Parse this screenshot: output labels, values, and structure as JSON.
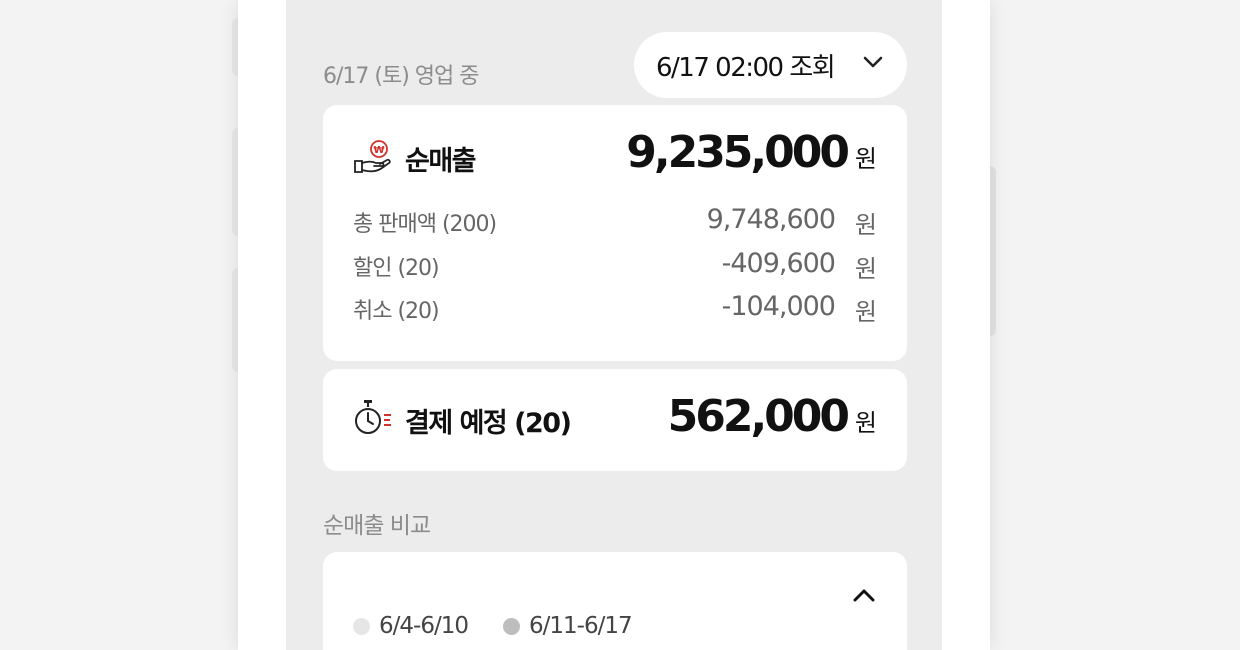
{
  "status": {
    "text": "6/17 (토) 영업 중"
  },
  "query": {
    "label": "6/17 02:00 조회"
  },
  "net_sales": {
    "title": "순매출",
    "amount": "9,235,000",
    "unit": "원",
    "rows": [
      {
        "label": "총 판매액 (200)",
        "amount": "9,748,600",
        "unit": "원"
      },
      {
        "label": "할인 (20)",
        "amount": "-409,600",
        "unit": "원"
      },
      {
        "label": "취소 (20)",
        "amount": "-104,000",
        "unit": "원"
      }
    ]
  },
  "pending": {
    "title": "결제 예정 (20)",
    "amount": "562,000",
    "unit": "원"
  },
  "compare": {
    "title": "순매출 비교",
    "legend": [
      {
        "label": "6/4-6/10",
        "color": "#e6e6e6"
      },
      {
        "label": "6/11-6/17",
        "color": "#bdbdbd"
      }
    ]
  },
  "colors": {
    "accent": "#d0312d",
    "screen_bg": "#ececec",
    "card_bg": "#ffffff"
  },
  "icons": {
    "net_sales": "hand-coin-icon",
    "pending": "stopwatch-icon",
    "expand": "chevron-down-icon",
    "collapse": "chevron-up-icon"
  }
}
